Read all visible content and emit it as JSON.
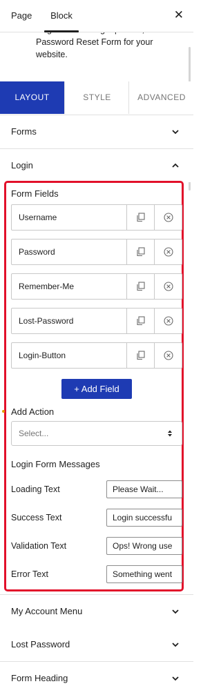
{
  "header": {
    "tab_page": "Page",
    "tab_block": "Block",
    "close": "✕"
  },
  "description": "Registration & Signup Form, Password Reset Form for your website.",
  "settings_tabs": {
    "layout": "LAYOUT",
    "style": "STYLE",
    "advanced": "ADVANCED"
  },
  "panels": {
    "forms": "Forms",
    "login": "Login",
    "my_account_menu": "My Account Menu",
    "lost_password": "Lost Password",
    "form_heading": "Form Heading"
  },
  "login": {
    "form_fields_label": "Form Fields",
    "fields": [
      "Username",
      "Password",
      "Remember-Me",
      "Lost-Password",
      "Login-Button"
    ],
    "add_field": "+ Add Field",
    "add_action_label": "Add Action",
    "add_action_placeholder": "Select...",
    "messages_label": "Login Form Messages",
    "messages": [
      {
        "label": "Loading Text",
        "value": "Please Wait..."
      },
      {
        "label": "Success Text",
        "value": "Login successfu"
      },
      {
        "label": "Validation Text",
        "value": "Ops! Wrong use"
      },
      {
        "label": "Error Text",
        "value": "Something went"
      }
    ]
  },
  "colors": {
    "accent": "#1e3bb3",
    "highlight_border": "#e2102a"
  }
}
